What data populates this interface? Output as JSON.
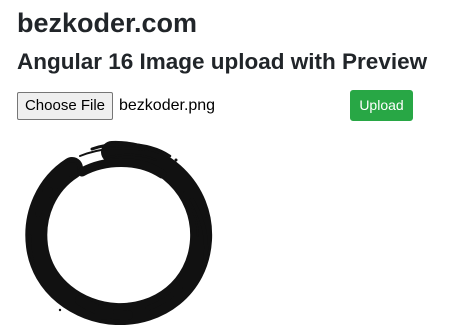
{
  "header": {
    "site_title": "bezkoder.com",
    "page_heading": "Angular 16 Image upload with Preview"
  },
  "upload_form": {
    "choose_file_label": "Choose File",
    "selected_file_name": "bezkoder.png",
    "upload_label": "Upload",
    "upload_color": "#28a745"
  },
  "preview": {
    "icon": "enso-circle-brush-icon",
    "ink_color": "#111111"
  }
}
